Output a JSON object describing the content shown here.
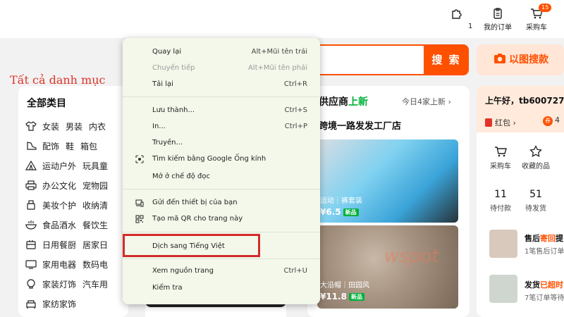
{
  "topbar": {
    "first_count": "1",
    "orders_label": "我的订单",
    "cart_label": "采购车",
    "cart_badge": "15"
  },
  "overlay_label": "Tất cả danh mục",
  "search": {
    "button_label": "搜 索"
  },
  "image_search": {
    "label": "以图搜款"
  },
  "categories": {
    "title": "全部类目",
    "rows": [
      {
        "icon": "shirt-icon",
        "items": [
          "女装",
          "男装",
          "内衣"
        ]
      },
      {
        "icon": "shoe-icon",
        "items": [
          "配饰",
          "鞋",
          "箱包"
        ]
      },
      {
        "icon": "tent-icon",
        "items": [
          "运动户外",
          "玩具童"
        ]
      },
      {
        "icon": "printer-icon",
        "items": [
          "办公文化",
          "宠物园"
        ]
      },
      {
        "icon": "cosmetics-icon",
        "items": [
          "美妆个护",
          "收纳清"
        ]
      },
      {
        "icon": "food-icon",
        "items": [
          "食品酒水",
          "餐饮生"
        ]
      },
      {
        "icon": "kitchen-icon",
        "items": [
          "日用餐厨",
          "居家日"
        ]
      },
      {
        "icon": "appliance-icon",
        "items": [
          "家用电器",
          "数码电"
        ]
      },
      {
        "icon": "lamp-icon",
        "items": [
          "家装灯饰",
          "汽车用"
        ]
      },
      {
        "icon": "sofa-icon",
        "items": [
          "家纺家饰"
        ]
      }
    ]
  },
  "supplier": {
    "title_prefix": "供应商",
    "title_highlight": "上新",
    "today": "今日4家上新",
    "subtitle": "跨境一路发发工厂店",
    "products": [
      {
        "caption": "运动｜裤套装",
        "price": "¥6.5",
        "badge": "新品"
      },
      {
        "caption": "大沿帽｜田园风",
        "price": "¥11.8",
        "badge": "新品"
      }
    ],
    "watermark": "wspot"
  },
  "user": {
    "greeting": "上午好，tb600727",
    "hongbao": "红包",
    "coupon_count": "4",
    "coupon_icon_text": "券",
    "quick": [
      {
        "label": "采购车",
        "icon": "cart-icon"
      },
      {
        "label": "收藏的品",
        "icon": "star-icon"
      }
    ],
    "stats": [
      {
        "num": "11",
        "label": "待付款"
      },
      {
        "num": "51",
        "label": "待发货"
      }
    ],
    "notices": [
      {
        "title_prefix": "售后",
        "title_highlight": "寄回",
        "title_suffix": "提",
        "sub": "1笔售后订单"
      },
      {
        "title_prefix": "发货",
        "title_highlight": "已超时",
        "title_suffix": "",
        "sub": "7笔订单等待"
      }
    ]
  },
  "context_menu": {
    "items": [
      {
        "label": "Quay lại",
        "shortcut": "Alt+Mũi tên trái",
        "disabled": false
      },
      {
        "label": "Chuyển tiếp",
        "shortcut": "Alt+Mũi tên phải",
        "disabled": true
      },
      {
        "label": "Tải lại",
        "shortcut": "Ctrl+R",
        "disabled": false
      },
      {
        "label": "Lưu thành...",
        "shortcut": "Ctrl+S",
        "disabled": false
      },
      {
        "label": "In...",
        "shortcut": "Ctrl+P",
        "disabled": false
      },
      {
        "label": "Truyền...",
        "shortcut": "",
        "disabled": false
      },
      {
        "label": "Tìm kiếm bằng Google Ống kính",
        "shortcut": "",
        "icon": "lens-icon",
        "disabled": false
      },
      {
        "label": "Mở ở chế độ đọc",
        "shortcut": "",
        "disabled": false
      },
      {
        "label": "Gửi đến thiết bị của bạn",
        "shortcut": "",
        "icon": "devices-icon",
        "disabled": false
      },
      {
        "label": "Tạo mã QR cho trang này",
        "shortcut": "",
        "icon": "qr-icon",
        "disabled": false
      },
      {
        "label": "Dịch sang Tiếng Việt",
        "shortcut": "",
        "disabled": false,
        "highlighted": true
      },
      {
        "label": "Xem nguồn trang",
        "shortcut": "Ctrl+U",
        "disabled": false
      },
      {
        "label": "Kiểm tra",
        "shortcut": "",
        "disabled": false
      }
    ]
  },
  "colors": {
    "accent": "#ff5000",
    "green": "#00b03b",
    "highlight_box": "#d42b2b",
    "menu_bg": "#f3f8ea"
  }
}
